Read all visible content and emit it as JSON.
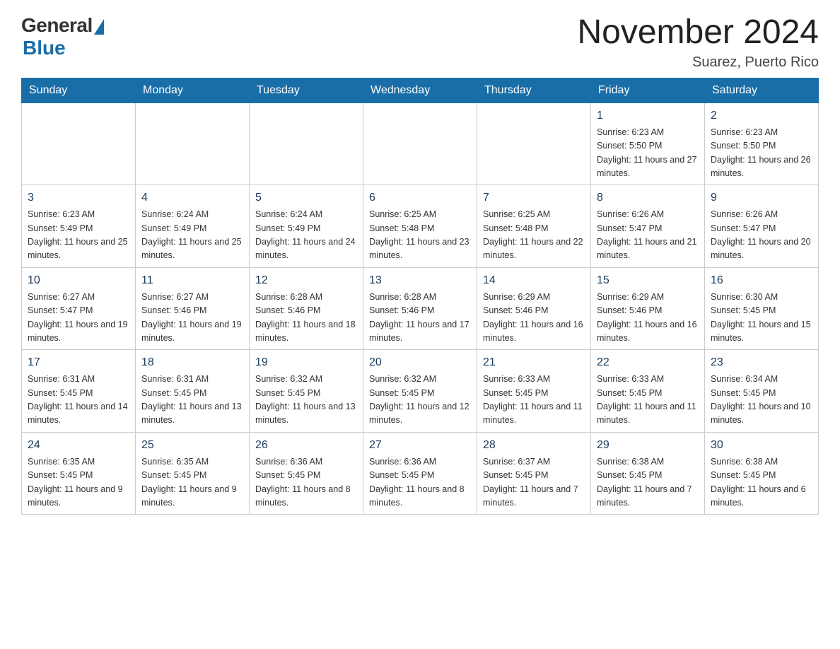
{
  "header": {
    "logo_general": "General",
    "logo_blue": "Blue",
    "title": "November 2024",
    "subtitle": "Suarez, Puerto Rico"
  },
  "days_header": [
    "Sunday",
    "Monday",
    "Tuesday",
    "Wednesday",
    "Thursday",
    "Friday",
    "Saturday"
  ],
  "weeks": [
    [
      {
        "day": "",
        "sunrise": "",
        "sunset": "",
        "daylight": ""
      },
      {
        "day": "",
        "sunrise": "",
        "sunset": "",
        "daylight": ""
      },
      {
        "day": "",
        "sunrise": "",
        "sunset": "",
        "daylight": ""
      },
      {
        "day": "",
        "sunrise": "",
        "sunset": "",
        "daylight": ""
      },
      {
        "day": "",
        "sunrise": "",
        "sunset": "",
        "daylight": ""
      },
      {
        "day": "1",
        "sunrise": "Sunrise: 6:23 AM",
        "sunset": "Sunset: 5:50 PM",
        "daylight": "Daylight: 11 hours and 27 minutes."
      },
      {
        "day": "2",
        "sunrise": "Sunrise: 6:23 AM",
        "sunset": "Sunset: 5:50 PM",
        "daylight": "Daylight: 11 hours and 26 minutes."
      }
    ],
    [
      {
        "day": "3",
        "sunrise": "Sunrise: 6:23 AM",
        "sunset": "Sunset: 5:49 PM",
        "daylight": "Daylight: 11 hours and 25 minutes."
      },
      {
        "day": "4",
        "sunrise": "Sunrise: 6:24 AM",
        "sunset": "Sunset: 5:49 PM",
        "daylight": "Daylight: 11 hours and 25 minutes."
      },
      {
        "day": "5",
        "sunrise": "Sunrise: 6:24 AM",
        "sunset": "Sunset: 5:49 PM",
        "daylight": "Daylight: 11 hours and 24 minutes."
      },
      {
        "day": "6",
        "sunrise": "Sunrise: 6:25 AM",
        "sunset": "Sunset: 5:48 PM",
        "daylight": "Daylight: 11 hours and 23 minutes."
      },
      {
        "day": "7",
        "sunrise": "Sunrise: 6:25 AM",
        "sunset": "Sunset: 5:48 PM",
        "daylight": "Daylight: 11 hours and 22 minutes."
      },
      {
        "day": "8",
        "sunrise": "Sunrise: 6:26 AM",
        "sunset": "Sunset: 5:47 PM",
        "daylight": "Daylight: 11 hours and 21 minutes."
      },
      {
        "day": "9",
        "sunrise": "Sunrise: 6:26 AM",
        "sunset": "Sunset: 5:47 PM",
        "daylight": "Daylight: 11 hours and 20 minutes."
      }
    ],
    [
      {
        "day": "10",
        "sunrise": "Sunrise: 6:27 AM",
        "sunset": "Sunset: 5:47 PM",
        "daylight": "Daylight: 11 hours and 19 minutes."
      },
      {
        "day": "11",
        "sunrise": "Sunrise: 6:27 AM",
        "sunset": "Sunset: 5:46 PM",
        "daylight": "Daylight: 11 hours and 19 minutes."
      },
      {
        "day": "12",
        "sunrise": "Sunrise: 6:28 AM",
        "sunset": "Sunset: 5:46 PM",
        "daylight": "Daylight: 11 hours and 18 minutes."
      },
      {
        "day": "13",
        "sunrise": "Sunrise: 6:28 AM",
        "sunset": "Sunset: 5:46 PM",
        "daylight": "Daylight: 11 hours and 17 minutes."
      },
      {
        "day": "14",
        "sunrise": "Sunrise: 6:29 AM",
        "sunset": "Sunset: 5:46 PM",
        "daylight": "Daylight: 11 hours and 16 minutes."
      },
      {
        "day": "15",
        "sunrise": "Sunrise: 6:29 AM",
        "sunset": "Sunset: 5:46 PM",
        "daylight": "Daylight: 11 hours and 16 minutes."
      },
      {
        "day": "16",
        "sunrise": "Sunrise: 6:30 AM",
        "sunset": "Sunset: 5:45 PM",
        "daylight": "Daylight: 11 hours and 15 minutes."
      }
    ],
    [
      {
        "day": "17",
        "sunrise": "Sunrise: 6:31 AM",
        "sunset": "Sunset: 5:45 PM",
        "daylight": "Daylight: 11 hours and 14 minutes."
      },
      {
        "day": "18",
        "sunrise": "Sunrise: 6:31 AM",
        "sunset": "Sunset: 5:45 PM",
        "daylight": "Daylight: 11 hours and 13 minutes."
      },
      {
        "day": "19",
        "sunrise": "Sunrise: 6:32 AM",
        "sunset": "Sunset: 5:45 PM",
        "daylight": "Daylight: 11 hours and 13 minutes."
      },
      {
        "day": "20",
        "sunrise": "Sunrise: 6:32 AM",
        "sunset": "Sunset: 5:45 PM",
        "daylight": "Daylight: 11 hours and 12 minutes."
      },
      {
        "day": "21",
        "sunrise": "Sunrise: 6:33 AM",
        "sunset": "Sunset: 5:45 PM",
        "daylight": "Daylight: 11 hours and 11 minutes."
      },
      {
        "day": "22",
        "sunrise": "Sunrise: 6:33 AM",
        "sunset": "Sunset: 5:45 PM",
        "daylight": "Daylight: 11 hours and 11 minutes."
      },
      {
        "day": "23",
        "sunrise": "Sunrise: 6:34 AM",
        "sunset": "Sunset: 5:45 PM",
        "daylight": "Daylight: 11 hours and 10 minutes."
      }
    ],
    [
      {
        "day": "24",
        "sunrise": "Sunrise: 6:35 AM",
        "sunset": "Sunset: 5:45 PM",
        "daylight": "Daylight: 11 hours and 9 minutes."
      },
      {
        "day": "25",
        "sunrise": "Sunrise: 6:35 AM",
        "sunset": "Sunset: 5:45 PM",
        "daylight": "Daylight: 11 hours and 9 minutes."
      },
      {
        "day": "26",
        "sunrise": "Sunrise: 6:36 AM",
        "sunset": "Sunset: 5:45 PM",
        "daylight": "Daylight: 11 hours and 8 minutes."
      },
      {
        "day": "27",
        "sunrise": "Sunrise: 6:36 AM",
        "sunset": "Sunset: 5:45 PM",
        "daylight": "Daylight: 11 hours and 8 minutes."
      },
      {
        "day": "28",
        "sunrise": "Sunrise: 6:37 AM",
        "sunset": "Sunset: 5:45 PM",
        "daylight": "Daylight: 11 hours and 7 minutes."
      },
      {
        "day": "29",
        "sunrise": "Sunrise: 6:38 AM",
        "sunset": "Sunset: 5:45 PM",
        "daylight": "Daylight: 11 hours and 7 minutes."
      },
      {
        "day": "30",
        "sunrise": "Sunrise: 6:38 AM",
        "sunset": "Sunset: 5:45 PM",
        "daylight": "Daylight: 11 hours and 6 minutes."
      }
    ]
  ]
}
